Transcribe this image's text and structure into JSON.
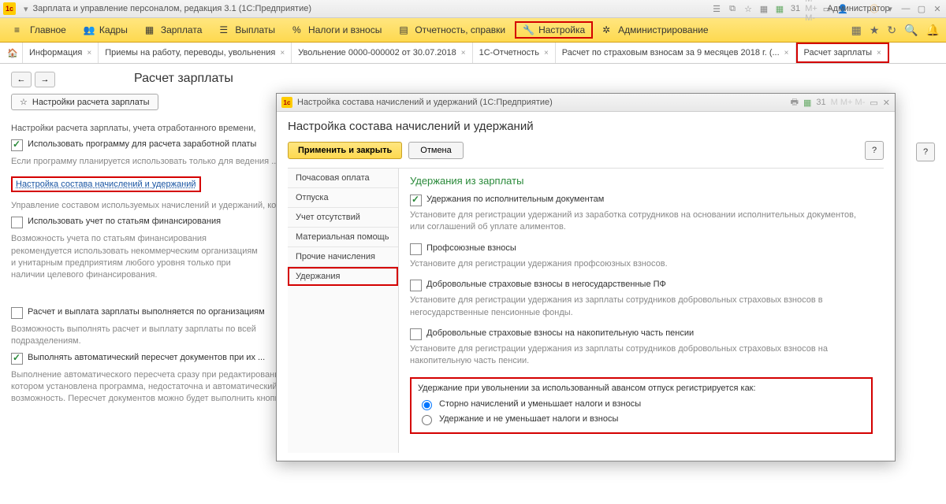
{
  "titlebar": {
    "text": "Зарплата и управление персоналом, редакция 3.1  (1С:Предприятие)",
    "user": "Администратор"
  },
  "menu": {
    "items": [
      {
        "label": "Главное"
      },
      {
        "label": "Кадры"
      },
      {
        "label": "Зарплата"
      },
      {
        "label": "Выплаты"
      },
      {
        "label": "Налоги и взносы"
      },
      {
        "label": "Отчетность, справки"
      },
      {
        "label": "Настройка",
        "highlight": true
      },
      {
        "label": "Администрирование"
      }
    ]
  },
  "tabs": [
    {
      "label": "Информация"
    },
    {
      "label": "Приемы на работу, переводы, увольнения"
    },
    {
      "label": "Увольнение 0000-000002 от 30.07.2018"
    },
    {
      "label": "1С-Отчетность"
    },
    {
      "label": "Расчет по страховым взносам за 9 месяцев 2018 г. (..."
    },
    {
      "label": "Расчет зарплаты",
      "highlight": true
    }
  ],
  "page": {
    "title": "Расчет зарплаты",
    "settings_btn": "Настройки расчета зарплаты",
    "intro": "Настройки расчета зарплаты, учета отработанного времени,",
    "chk1": "Использовать программу для расчета заработной платы",
    "chk1_desc": "Если программу планируется использовать только для веде­ния ... предприятия, снимите этот флажок.",
    "link": "Настройка состава начислений и удержаний",
    "link_desc": "Управление составом используемых начислений и удержан­ий, командировок, удержание профсоюзных взносов и т.д.",
    "chk2": "Использовать учет по статьям финансирования",
    "chk2_desc": "Возможность учета по статьям финансирования рекомендуется использовать некоммерческим организациям и унитарным предприятиям любого уровня только при наличии целевого финансирования.",
    "chk3": "Расчет и выплата зарплаты выполняется по организаци­ям",
    "chk3_desc": "Возможность выполнять расчет и выплату зарплаты по всей подразделениям.",
    "chk4": "Выполнять автоматический пересчет документов при их ...",
    "chk4_desc": "Выполнение автоматического пересчета сразу при редактировании документа. Если производительность вашего компьютера или сервера, на котором установлена программа, недостаточна и автоматический пересчет документа выполняется с большими задержками, не используйте эту возможность. Пересчет документов можно будет выполнить кнопкой \"Пересчитать\"."
  },
  "modal": {
    "title": "Настройка состава начислений и удержаний  (1С:Предприятие)",
    "heading": "Настройка состава начислений и удержаний",
    "apply": "Применить и закрыть",
    "cancel": "Отмена",
    "sidetabs": [
      {
        "label": "Почасовая оплата"
      },
      {
        "label": "Отпуска"
      },
      {
        "label": "Учет отсутствий"
      },
      {
        "label": "Материальная помощь"
      },
      {
        "label": "Прочие начисления"
      },
      {
        "label": "Удержания",
        "highlight": true
      }
    ],
    "section_title": "Удержания из зарплаты",
    "opts": [
      {
        "label": "Удержания по исполнительным документам",
        "checked": true,
        "desc": "Установите для регистрации удержаний из заработка сотрудников на основании исполнительных документов, или соглашений об уплате алиментов."
      },
      {
        "label": "Профсоюзные взносы",
        "checked": false,
        "desc": "Установите для регистрации удержания профсоюзных взносов."
      },
      {
        "label": "Добровольные страховые взносы в негосударственные ПФ",
        "checked": false,
        "desc": "Установите для регистрации удержания из зарплаты сотрудников добровольных страховых взносов в негосударственные пенсионные фонды."
      },
      {
        "label": "Добровольные страховые взносы на накопительную часть пенсии",
        "checked": false,
        "desc": "Установите для регистрации удержания из зарплаты сотрудников добровольных страховых взносов на накопительную часть пенсии."
      }
    ],
    "radio": {
      "title": "Удержание при увольнении за использованный авансом отпуск регистрируется как:",
      "opt1": "Сторно начислений и уменьшает налоги и взносы",
      "opt2": "Удержание и не уменьшает налоги и взносы"
    }
  }
}
